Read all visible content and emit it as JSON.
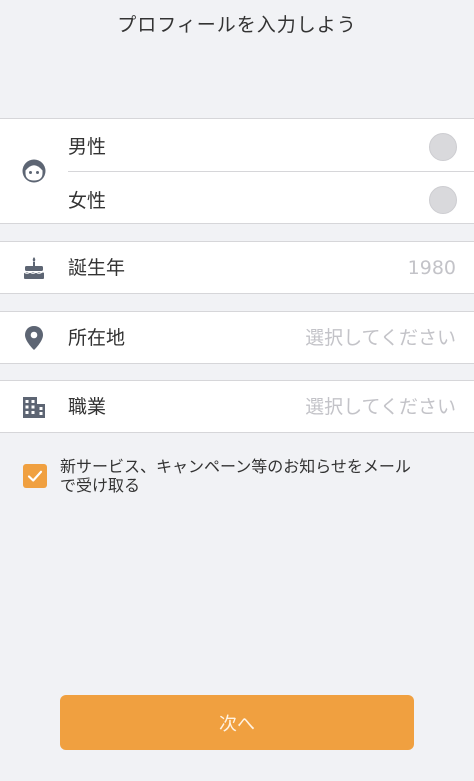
{
  "header": {
    "title": "プロフィールを入力しよう"
  },
  "gender": {
    "icon": "face-icon",
    "options": [
      {
        "label": "男性",
        "selected": false
      },
      {
        "label": "女性",
        "selected": false
      }
    ]
  },
  "birth_year": {
    "icon": "birthday-cake-icon",
    "label": "誕生年",
    "value": "1980"
  },
  "location": {
    "icon": "map-pin-icon",
    "label": "所在地",
    "placeholder": "選択してください"
  },
  "occupation": {
    "icon": "building-icon",
    "label": "職業",
    "placeholder": "選択してください"
  },
  "consent": {
    "checked": true,
    "line1": "新サービス、キャンペーン等のお知らせをメール",
    "line2": "で受け取る"
  },
  "footer": {
    "next_label": "次へ"
  },
  "colors": {
    "accent": "#f0a040",
    "icon": "#5d6573",
    "background": "#f1f2f5"
  }
}
